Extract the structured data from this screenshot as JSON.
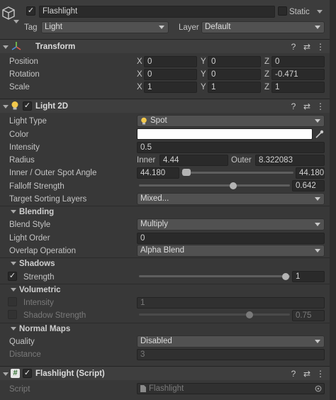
{
  "object": {
    "name": "Flashlight",
    "static_label": "Static",
    "tag_label": "Tag",
    "tag_value": "Light",
    "layer_label": "Layer",
    "layer_value": "Default"
  },
  "transform": {
    "title": "Transform",
    "position_label": "Position",
    "rotation_label": "Rotation",
    "scale_label": "Scale",
    "axis_x": "X",
    "axis_y": "Y",
    "axis_z": "Z",
    "position": [
      "0",
      "0",
      "0"
    ],
    "rotation": [
      "0",
      "0",
      "-0.471"
    ],
    "scale": [
      "1",
      "1",
      "1"
    ]
  },
  "light2d": {
    "title": "Light 2D",
    "light_type_label": "Light Type",
    "light_type_value": "Spot",
    "color_label": "Color",
    "color_value": "#ffffff",
    "intensity_label": "Intensity",
    "intensity_value": "0.5",
    "radius_label": "Radius",
    "inner_label": "Inner",
    "inner_value": "4.44",
    "outer_label": "Outer",
    "outer_value": "8.322083",
    "spot_angle_label": "Inner / Outer Spot Angle",
    "spot_inner_value": "44.180",
    "spot_outer_value": "44.180",
    "falloff_label": "Falloff Strength",
    "falloff_value": "0.642",
    "sorting_layers_label": "Target Sorting Layers",
    "sorting_layers_value": "Mixed...",
    "blending_title": "Blending",
    "blend_style_label": "Blend Style",
    "blend_style_value": "Multiply",
    "light_order_label": "Light Order",
    "light_order_value": "0",
    "overlap_label": "Overlap Operation",
    "overlap_value": "Alpha Blend",
    "shadows_title": "Shadows",
    "shadow_strength_label": "Strength",
    "shadow_strength_value": "1",
    "volumetric_title": "Volumetric",
    "vol_intensity_label": "Intensity",
    "vol_intensity_value": "1",
    "vol_shadow_label": "Shadow Strength",
    "vol_shadow_value": "0.75",
    "normal_maps_title": "Normal Maps",
    "quality_label": "Quality",
    "quality_value": "Disabled",
    "distance_label": "Distance",
    "distance_value": "3"
  },
  "script": {
    "title": "Flashlight (Script)",
    "script_label": "Script",
    "script_value": "Flashlight"
  },
  "icons": {
    "help": "?",
    "presets": "⇄",
    "menu": "⋮",
    "check": "✓"
  },
  "colors": {
    "background": "#383838",
    "header": "#3e3e3e",
    "field": "#2a2a2a",
    "dropdown": "#515151"
  }
}
